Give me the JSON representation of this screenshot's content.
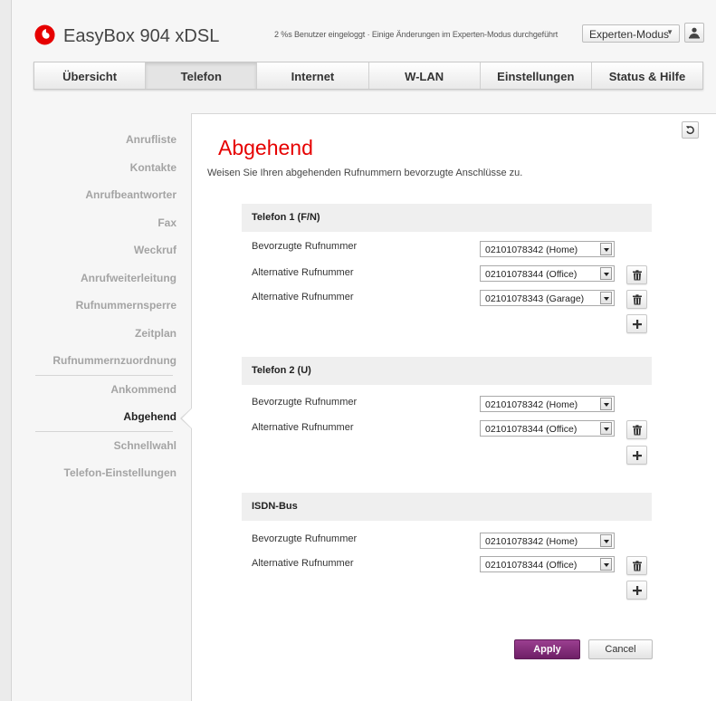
{
  "header": {
    "title": "EasyBox 904 xDSL",
    "status_text": "2 %s Benutzer eingeloggt · Einige Änderungen im Experten-Modus durchgeführt",
    "mode_select": "Experten-Modus",
    "brand_color": "#e60000"
  },
  "tabs": [
    {
      "label": "Übersicht"
    },
    {
      "label": "Telefon",
      "active": true
    },
    {
      "label": "Internet"
    },
    {
      "label": "W-LAN"
    },
    {
      "label": "Einstellungen"
    },
    {
      "label": "Status & Hilfe"
    }
  ],
  "sidebar": {
    "items": [
      {
        "label": "Anrufliste"
      },
      {
        "label": "Kontakte"
      },
      {
        "label": "Anrufbeantworter"
      },
      {
        "label": "Fax"
      },
      {
        "label": "Weckruf"
      },
      {
        "label": "Anrufweiterleitung"
      },
      {
        "label": "Rufnummernsperre"
      },
      {
        "label": "Zeitplan"
      },
      {
        "label": "Rufnummernzuordnung"
      },
      {
        "label": "Ankommend"
      },
      {
        "label": "Abgehend",
        "current": true
      },
      {
        "label": "Schnellwahl"
      },
      {
        "label": "Telefon-Einstellungen"
      }
    ]
  },
  "main": {
    "title": "Abgehend",
    "intro": "Weisen Sie Ihren abgehenden Rufnummern bevorzugte Anschlüsse zu.",
    "sections": [
      {
        "title": "Telefon 1 (F/N)",
        "rows": [
          {
            "label": "Bevorzugte Rufnummer",
            "value": "02101078342 (Home)"
          },
          {
            "label": "Alternative Rufnummer",
            "value": "02101078344 (Office)"
          },
          {
            "label": "Alternative Rufnummer",
            "value": "02101078343 (Garage)"
          }
        ]
      },
      {
        "title": "Telefon 2 (U)",
        "rows": [
          {
            "label": "Bevorzugte Rufnummer",
            "value": "02101078342 (Home)"
          },
          {
            "label": "Alternative Rufnummer",
            "value": "02101078344 (Office)"
          }
        ]
      },
      {
        "title": "ISDN-Bus",
        "rows": [
          {
            "label": "Bevorzugte Rufnummer",
            "value": "02101078342 (Home)"
          },
          {
            "label": "Alternative Rufnummer",
            "value": "02101078344 (Office)"
          }
        ]
      }
    ],
    "apply_label": "Apply",
    "cancel_label": "Cancel",
    "apply_color": "#7d2a74"
  },
  "icons": {
    "logo": "vodafone-logo-icon",
    "user": "user-icon",
    "reset": "undo-icon",
    "delete": "trash-icon",
    "add": "plus-icon"
  }
}
